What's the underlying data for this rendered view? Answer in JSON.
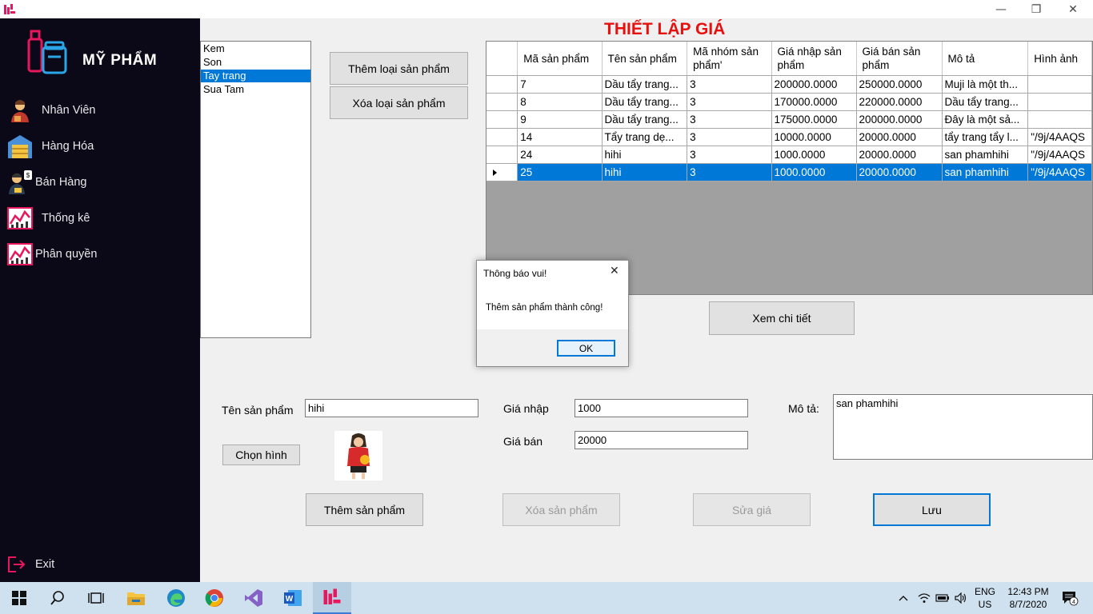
{
  "window": {
    "minimize": "—",
    "maximize": "❐",
    "close": "✕"
  },
  "sidebar": {
    "brand": "MỸ PHẨM",
    "items": [
      {
        "label": "Nhân Viên",
        "icon": "staff-icon"
      },
      {
        "label": "Hàng Hóa",
        "icon": "warehouse-icon"
      },
      {
        "label": "Bán Hàng",
        "icon": "sales-icon"
      },
      {
        "label": "Thống kê",
        "icon": "statistics-icon"
      },
      {
        "label": "Phân quyền",
        "icon": "permissions-icon"
      }
    ],
    "exit": "Exit"
  },
  "category_list": {
    "items": [
      "Kem",
      "Son",
      "Tay trang",
      "Sua Tam"
    ],
    "selected": "Tay trang"
  },
  "category_buttons": {
    "add": "Thêm loại sản phẩm",
    "delete": "Xóa loại sản phẩm"
  },
  "page_title": "THIẾT LẬP GIÁ",
  "grid": {
    "columns": [
      "Mã sản phẩm",
      "Tên sản phẩm",
      "Mã nhóm sản phẩm'",
      "Giá nhập sản phẩm",
      "Giá bán sản phẩm",
      "Mô tả",
      "Hình ảnh"
    ],
    "rows": [
      [
        "7",
        "Dầu tẩy trang...",
        "3",
        "200000.0000",
        "250000.0000",
        "Muji là một th...",
        ""
      ],
      [
        "8",
        "Dầu tẩy trang...",
        "3",
        "170000.0000",
        "220000.0000",
        "Dầu tẩy trang...",
        ""
      ],
      [
        "9",
        "Dầu tẩy trang...",
        "3",
        "175000.0000",
        "200000.0000",
        "Đây là một sả...",
        ""
      ],
      [
        "14",
        "Tẩy trang dẹ...",
        "3",
        "10000.0000",
        "20000.0000",
        "tẩy trang tẩy l...",
        "\"/9j/4AAQS"
      ],
      [
        "24",
        "hihi",
        "3",
        "1000.0000",
        "20000.0000",
        "san phamhihi",
        "\"/9j/4AAQS"
      ],
      [
        "25",
        "hihi",
        "3",
        "1000.0000",
        "20000.0000",
        "san phamhihi",
        "\"/9j/4AAQS"
      ]
    ],
    "selected_row": 5
  },
  "detail_button": "Xem chi tiết",
  "form": {
    "name_label": "Tên sản phẩm",
    "name_value": "hihi",
    "choose_image": "Chọn hình",
    "import_price_label": "Giá nhập",
    "import_price_value": "1000",
    "sale_price_label": "Giá bán",
    "sale_price_value": "20000",
    "desc_label": "Mô tả:",
    "desc_value": "san phamhihi"
  },
  "actions": {
    "add": "Thêm sản phẩm",
    "delete": "Xóa sản phẩm",
    "edit_price": "Sửa giá",
    "save": "Lưu"
  },
  "dialog": {
    "title": "Thông báo vui!",
    "message": "Thêm sản phẩm thành công!",
    "ok": "OK"
  },
  "taskbar": {
    "apps": [
      "start-icon",
      "search-icon",
      "task-view-icon",
      "file-explorer-icon",
      "edge-icon",
      "chrome-icon",
      "visual-studio-icon",
      "word-icon",
      "app-icon"
    ],
    "lang_top": "ENG",
    "lang_bottom": "US",
    "time": "12:43 PM",
    "date": "8/7/2020",
    "notifications": "4"
  },
  "colors": {
    "sidebar_bg": "#0b0918",
    "title_red": "#e8100f",
    "selection_blue": "#0078d7",
    "taskbar_bg": "#cfe0ee"
  }
}
